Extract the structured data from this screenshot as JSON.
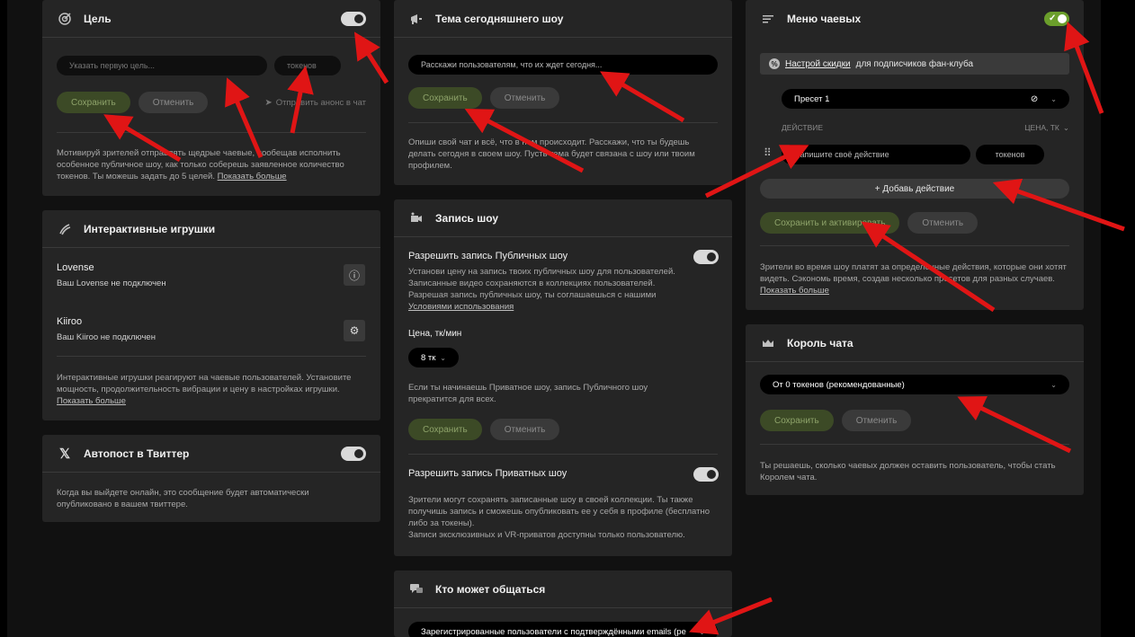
{
  "goal": {
    "title": "Цель",
    "goal_placeholder": "Указать первую цель...",
    "tokens_placeholder": "токенов",
    "save": "Сохранить",
    "cancel": "Отменить",
    "send_to_chat": "Отправить анонс в чат",
    "desc": "Мотивируй зрителей отправлять щедрые чаевые, пообещав исполнить особенное публичное шоу, как только соберешь заявленное количество токенов. Ты можешь задать до 5 целей.",
    "more": "Показать больше"
  },
  "toys": {
    "title": "Интерактивные игрушки",
    "items": [
      {
        "name": "Lovense",
        "status": "Ваш Lovense не подключен"
      },
      {
        "name": "Kiiroo",
        "status": "Ваш Kiiroo не подключен"
      }
    ],
    "desc": "Интерактивные игрушки реагируют на чаевые пользователей. Установите мощность, продолжительность вибрации и цену в настройках игрушки.",
    "more": "Показать больше"
  },
  "twitter": {
    "title": "Автопост в Твиттер",
    "desc": "Когда вы выйдете онлайн, это сообщение будет автоматически опубликовано в вашем твиттере."
  },
  "topic": {
    "title": "Тема сегодняшнего шоу",
    "placeholder": "Расскажи пользователям, что их ждет сегодня...",
    "save": "Сохранить",
    "cancel": "Отменить",
    "desc": "Опиши свой чат и всё, что в нем происходит. Расскажи, что ты будешь делать сегодня в своем шоу. Пусть тема будет связана с шоу или твоим профилем."
  },
  "record": {
    "title": "Запись шоу",
    "public_label": "Разрешить запись Публичных шоу",
    "public_desc": "Установи цену на запись твоих публичных шоу для пользователей. Записанные видео сохраняются в коллекциях пользователей. Разрешая запись публичных шоу, ты соглашаешься с нашими",
    "terms": "Условиями использования",
    "price_label": "Цена, тк/мин",
    "price_value": "8 тк",
    "private_note": "Если ты начинаешь Приватное шоу, запись Публичного шоу прекратится для всех.",
    "save": "Сохранить",
    "cancel": "Отменить",
    "private_label": "Разрешить запись Приватных шоу",
    "private_desc": "Зрители могут сохранять записанные шоу в своей коллекции. Ты также получишь запись и сможешь опубликовать ее у себя в профиле (бесплатно либо за токены).",
    "private_desc2": "Записи эксклюзивных и VR-приватов доступны только пользователю."
  },
  "chat_who": {
    "title": "Кто может общаться",
    "value": "Зарегистрированные пользователи с подтверждёнными emails (ре"
  },
  "tip_menu": {
    "title": "Меню чаевых",
    "discount_link": "Настрой скидки",
    "discount_rest": "для подписчиков фан-клуба",
    "preset": "Пресет 1",
    "col_action": "ДЕЙСТВИЕ",
    "col_price": "ЦЕНА, ТК",
    "action_placeholder": "Напишите своё действие",
    "tokens_placeholder": "токенов",
    "add_action": "+ Добавь действие",
    "save_activate": "Сохранить и активировать",
    "cancel": "Отменить",
    "desc": "Зрители во время шоу платят за определенные действия, которые они хотят видеть. Сэкономь время, создав несколько пресетов для разных случаев.",
    "more": "Показать больше"
  },
  "king": {
    "title": "Король чата",
    "value": "От 0 токенов (рекомендованные)",
    "save": "Сохранить",
    "cancel": "Отменить",
    "desc": "Ты решаешь, сколько чаевых должен оставить пользователь, чтобы стать Королем чата."
  },
  "colors": {
    "accent_green": "#6b9e2b",
    "arrow_red": "#e01515",
    "card_bg": "#252525"
  }
}
